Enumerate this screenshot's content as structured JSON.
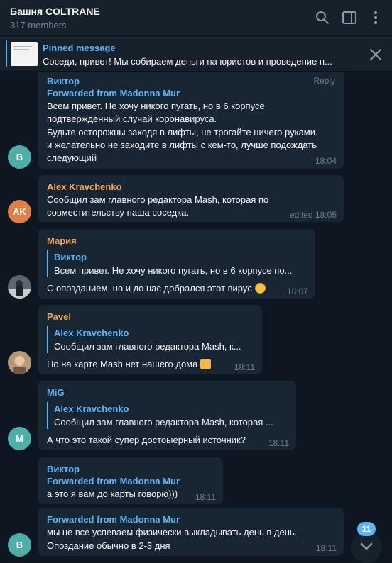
{
  "header": {
    "title": "Башня COLTRANE",
    "subtitle": "317 members"
  },
  "pinned": {
    "title": "Pinned message",
    "text": "Соседи, привет! Мы собираем деньги на юристов и проведение н..."
  },
  "colors": {
    "accent": "#5eb5f7",
    "orange": "#f0a35a",
    "background": "#0e1621",
    "bubble": "#182533"
  },
  "messages": [
    {
      "sender": "Виктор",
      "reply_label": "Reply",
      "forwarded": "Forwarded from Madonna Mur",
      "lines": [
        "Всем привет. Не хочу никого пугать, но в 6 корпусе",
        "подтвержденный случай коронавируса.",
        "Будьте осторожны заходя в лифты, не трогайте ничего руками.",
        "и желательно не заходите в лифты с кем-то, лучше подождать",
        "следующий"
      ],
      "time": "18:04",
      "avatar": "B"
    },
    {
      "sender": "Alex Kravchenko",
      "lines": [
        "Сообщил зам главного редактора Mash, которая по",
        "совместительству наша соседка."
      ],
      "time": "edited 18:05",
      "avatar": "AK"
    },
    {
      "sender": "Мария",
      "quote": {
        "name": "Виктор",
        "text": "Всем привет. Не хочу никого пугать, но в 6 корпусе по..."
      },
      "lines": [
        "С опозданием, но и до нас добрался этот вирус"
      ],
      "time": "18:07",
      "emoji": "grin-emoji"
    },
    {
      "sender": "Pavel",
      "quote": {
        "name": "Alex Kravchenko",
        "text": "Сообщил зам главного редактора Mash, к..."
      },
      "lines": [
        "Но на карте Mash нет нашего дома"
      ],
      "time": "18:11",
      "emoji": "shrug-emoji"
    },
    {
      "sender": "MiG",
      "quote": {
        "name": "Alex Kravchenko",
        "text": "Сообщил зам главного редактора Mash, которая ..."
      },
      "lines": [
        "А что это такой супер достоыерный источник?"
      ],
      "time": "18:11",
      "avatar": "M"
    },
    {
      "sender": "Виктор",
      "forwarded": "Forwarded from Madonna Mur",
      "lines": [
        "а это я вам до карты говорю)))"
      ],
      "time": "18:11"
    },
    {
      "forwarded": "Forwarded from Madonna Mur",
      "lines": [
        "мы не все успеваем физически выкладывать день в день.",
        "Опоздание обычно в 2-3 дня"
      ],
      "time": "18:11",
      "avatar": "B"
    }
  ],
  "scroll": {
    "unread_count": "11"
  }
}
